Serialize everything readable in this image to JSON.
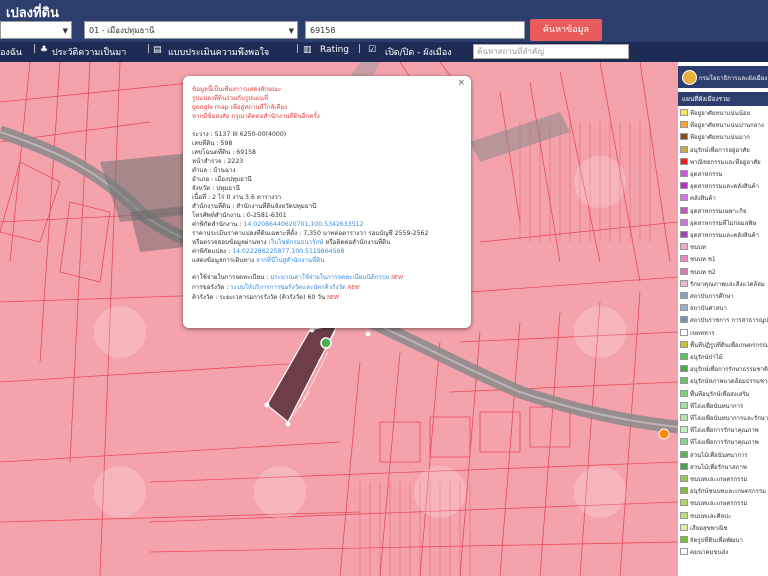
{
  "header": {
    "title": "เปลงที่ดิน",
    "province_select": "",
    "district_select": "01 - เมืองปทุมธานี",
    "parcel_input": "69158",
    "search_button": "ค้นหาข้อมูล"
  },
  "toolbar": {
    "item1": "องฉัน",
    "item2": "ประวัติความเป็นมา",
    "item3": "แบบประเมินความพึงพอใจ",
    "item4": "Rating",
    "item5": "เปิด/ปิด - ผังเมือง",
    "search_placeholder": "ค้นหาสถานที่สำคัญ"
  },
  "popup": {
    "note1": "ข้อมูลนี้เป็นเพียงการแสดงลักษณะ",
    "note2": "รูปแปลงที่ดินร่วมกับรูปแผนที่",
    "note3": "google map เพื่อสู่สถานที่ใกล้เคียง",
    "note4": "หากมีข้อสงสัย กรุณาติดต่อสำนักงานที่ดินอีกครั้ง",
    "sheet": "ระวาง : 5137 III 6250-00(4000)",
    "land_no": "เลขที่ดิน : 598",
    "deed_no": "เลขโฉนดที่ดิน : 69158",
    "survey_page": "หน้าสำรวจ : 2223",
    "tambon": "ตำบล : บ้านฉาง",
    "amphoe": "อำเภอ : เมืองปทุมธานี",
    "province": "จังหวัด : ปทุมธานี",
    "area": "เนื้อที่ : 2 ไร่ 0 งาน 3.6 ตารางวา",
    "office": "สำนักงานที่ดิน : สำนักงานที่ดินจังหวัดปทุมธานี",
    "phone": "โทรศัพท์สำนักงาน : 0-2581-6301",
    "office_coord_label": "ค่าพิกัดสำนักงาน :",
    "office_coord": "14.02086440620701,100.5342633512",
    "price": "ราคาประเมินราคาแปลงที่ดินเฉพาะที่ตั้ง : 7,350 บาทต่อตารางวา รอบบัญชี 2559-2562",
    "price2_label": "หรือตรวจสอบข้อมูลผ่านทาง",
    "price2_link": "เว็บไซต์กรมธนารักษ์",
    "price2_tail": "หรือติดต่อสำนักงานที่ดิน",
    "parcel_coord_label": "ค่าพิกัดแปลง :",
    "parcel_coord": "14.022286225877,100.5119864568",
    "route_label": "แสดงข้อมูลการเดินทาง",
    "route_link": "จากที่นี่ไปสู่สำนักงานที่ดิน",
    "q1_label": "ค่าใช้จ่ายในการจดทะเบียน :",
    "q1_link": "ประมาณค่าใช้จ่ายในการจดทะเบียนนิติกรรม",
    "q2_label": "การขอรังวัด :",
    "q2_link": "ระบบให้บริการการขอรังวัดและบัตรคิวรังวัด",
    "q3": "คิวรังวัด : ระยะเวลารอการรังวัด (คิวรังวัด) 60 วัน",
    "badge": "NEW",
    "close": "×"
  },
  "right_panel": {
    "agency": "กรมโยธาธิการและผังเมือง",
    "legend_title": "แผนที่ผังเมืองรวม",
    "legend": [
      {
        "label": "ที่อยู่อาศัยหนาแน่นน้อย",
        "color": "#f7e55a"
      },
      {
        "label": "ที่อยู่อาศัยหนาแน่นปานกลาง",
        "color": "#f7a733"
      },
      {
        "label": "ที่อยู่อาศัยหนาแน่นมาก",
        "color": "#8a4a1f"
      },
      {
        "label": "อนุรักษ์เพื่อการอยู่อาศัย",
        "color": "#c9a64a"
      },
      {
        "label": "พาณิชยกรรมและที่อยู่อาศัย",
        "color": "#e82020"
      },
      {
        "label": "อุตสาหกรรม",
        "color": "#c45ad8"
      },
      {
        "label": "อุตสาหกรรมและคลังสินค้า",
        "color": "#a733c9"
      },
      {
        "label": "คลังสินค้า",
        "color": "#d07ae0"
      },
      {
        "label": "อุตสาหกรรมเฉพาะกิจ",
        "color": "#b85ab8"
      },
      {
        "label": "อุตสาหกรรมที่ไม่ก่อมลพิษ",
        "color": "#c97ad8"
      },
      {
        "label": "อุตสาหกรรมและคลังสินค้า",
        "color": "#9a4ab0"
      },
      {
        "label": "ชนบท",
        "color": "#f0a8d0"
      },
      {
        "label": "ชนบท ช1",
        "color": "#e88ac0"
      },
      {
        "label": "ชนบท ช2",
        "color": "#d87ab0"
      },
      {
        "label": "รักษาคุณภาพและสิ่งแวดล้อม",
        "color": "#e8b8d8"
      },
      {
        "label": "สถาบันการศึกษา",
        "color": "#8aa0b8"
      },
      {
        "label": "สถาบันศาสนา",
        "color": "#9ab0c8"
      },
      {
        "label": "สถาบันราชการ การสาธารณูปโภค",
        "color": "#7a90a8"
      },
      {
        "label": "เขตทหาร",
        "color": "#ffffff"
      },
      {
        "label": "พื้นที่ปฏิรูปที่ดินเพื่อเกษตรกรรม",
        "color": "#c8c040"
      },
      {
        "label": "อนุรักษ์ป่าไม้",
        "color": "#5ac05a"
      },
      {
        "label": "อนุรักษ์เพื่อการรักษาธรรมชาติ",
        "color": "#4aa84a"
      },
      {
        "label": "อนุรักษ์สภาพแวดล้อมธรรมชาติ",
        "color": "#70c070"
      },
      {
        "label": "พื้นที่อนุรักษ์เพื่อส่งเสริม",
        "color": "#80d080"
      },
      {
        "label": "ที่โล่งเพื่อนันทนาการ",
        "color": "#a0e0a0"
      },
      {
        "label": "ที่โล่งเพื่อนันทนาการและรักษา",
        "color": "#b0e8b0"
      },
      {
        "label": "ที่โล่งเพื่อการรักษาคุณภาพ",
        "color": "#c0f0c0"
      },
      {
        "label": "ที่โล่งเพื่อการรักษาคุณภาพ",
        "color": "#90d090"
      },
      {
        "label": "สวนไม้เพื่อนันทนาการ",
        "color": "#60b060"
      },
      {
        "label": "สวนไม้เพื่อรักษาสภาพ",
        "color": "#50a050"
      },
      {
        "label": "ชนบทและเกษตรกรรม",
        "color": "#98c858"
      },
      {
        "label": "อนุรักษ์ชนบทและเกษตรกรรม",
        "color": "#88b848"
      },
      {
        "label": "ชนบทและเกษตรกรรม",
        "color": "#a8d868"
      },
      {
        "label": "ชนบทและศิลปะ",
        "color": "#b8e078"
      },
      {
        "label": "เสียอสุขพาณิช",
        "color": "#d8f0a8"
      },
      {
        "label": "จัดรูปที่ดินเพื่อพัฒนา",
        "color": "#78c030"
      },
      {
        "label": "คมนาคมขนส่ง",
        "color": "#ffffff"
      }
    ]
  }
}
